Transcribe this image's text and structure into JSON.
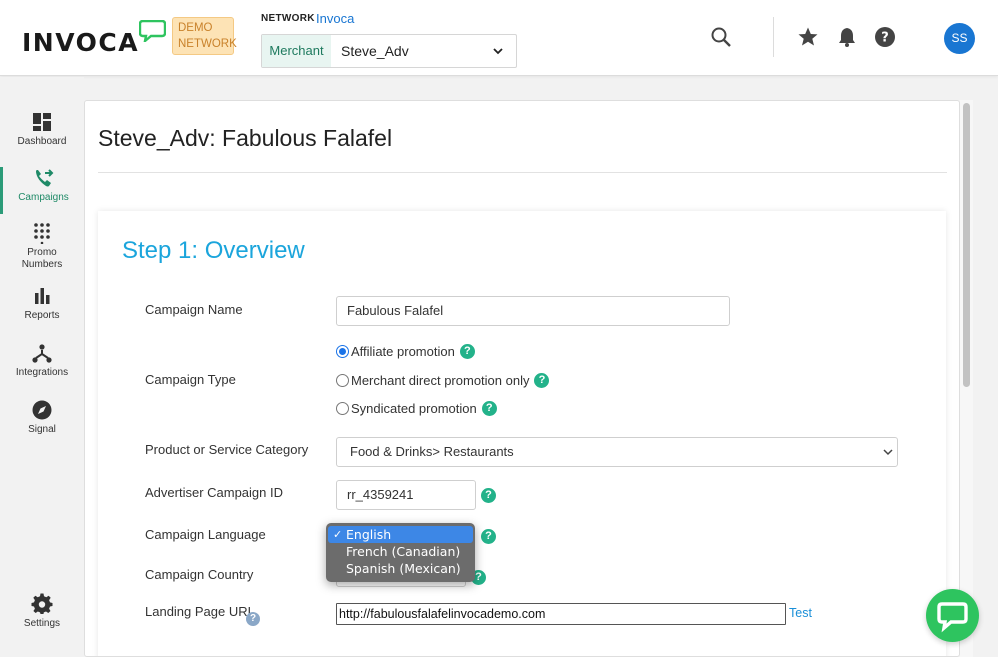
{
  "header": {
    "logo_text": "INVOCA",
    "logo_icon": "chat-bubble-logo-icon",
    "demo_badge_line1": "DEMO",
    "demo_badge_line2": "NETWORK",
    "network_label": "NETWORK",
    "network_value": "Invoca",
    "merchant_label": "Merchant",
    "merchant_value": "Steve_Adv",
    "avatar_initials": "SS",
    "icons": [
      "search-icon",
      "star-icon",
      "bell-icon",
      "help-icon"
    ],
    "brand_color": "#2ec45f",
    "accent_color": "#1976d2"
  },
  "sidebar": {
    "items": [
      {
        "label": "Dashboard",
        "icon": "dashboard-icon"
      },
      {
        "label": "Campaigns",
        "icon": "campaigns-phone-icon",
        "active": true
      },
      {
        "label": "Promo\nNumbers",
        "line1": "Promo",
        "line2": "Numbers",
        "icon": "keypad-icon"
      },
      {
        "label": "Reports",
        "icon": "bar-chart-icon"
      },
      {
        "label": "Integrations",
        "icon": "integrations-icon"
      },
      {
        "label": "Signal",
        "icon": "compass-icon"
      },
      {
        "label": "Settings",
        "icon": "gear-icon"
      }
    ],
    "active_color": "#2b9b78"
  },
  "page": {
    "title": "Steve_Adv: Fabulous Falafel",
    "step_title": "Step 1: Overview",
    "step_color": "#1ba5dc"
  },
  "form": {
    "campaign_name_label": "Campaign Name",
    "campaign_name_value": "Fabulous Falafel",
    "campaign_type_label": "Campaign Type",
    "campaign_type_options": [
      {
        "label": "Affiliate promotion",
        "checked": true
      },
      {
        "label": "Merchant direct promotion only",
        "checked": false
      },
      {
        "label": "Syndicated promotion",
        "checked": false
      }
    ],
    "category_label": "Product or Service Category",
    "category_value": "Food & Drinks> Restaurants",
    "advertiser_id_label": "Advertiser Campaign ID",
    "advertiser_id_value": "rr_4359241",
    "language_label": "Campaign Language",
    "language_options": [
      "English",
      "French (Canadian)",
      "Spanish (Mexican)"
    ],
    "language_selected": "English",
    "country_label": "Campaign Country",
    "landing_url_label": "Landing Page URL",
    "landing_url_value": "http://fabulousfalafelinvocademo.com",
    "test_link": "Test",
    "help_glyph": "?",
    "check_glyph": "✓"
  }
}
